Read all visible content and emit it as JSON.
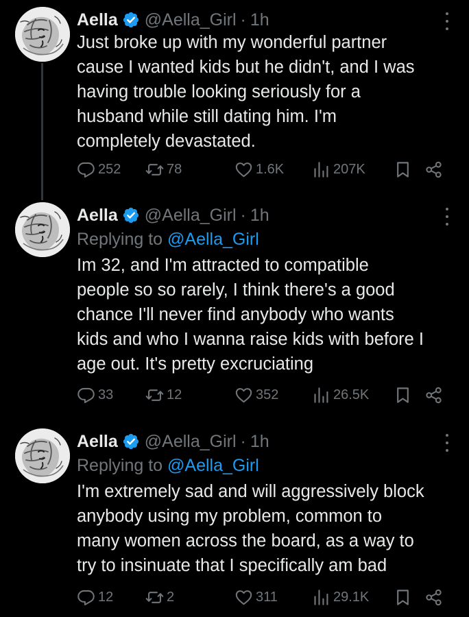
{
  "tweets": [
    {
      "name": "Aella",
      "handle": "@Aella_Girl",
      "dot": "·",
      "time": "1h",
      "reply_prefix": "",
      "reply_mention": "",
      "lines": [
        "Just broke up with my wonderful partner",
        "cause I wanted kids but he didn't, and I was",
        "having trouble looking seriously for a",
        "husband while still dating him. I'm",
        "completely devastated."
      ],
      "replies": "252",
      "reposts": "78",
      "likes": "1.6K",
      "views": "207K"
    },
    {
      "name": "Aella",
      "handle": "@Aella_Girl",
      "dot": "·",
      "time": "1h",
      "reply_prefix": "Replying to ",
      "reply_mention": "@Aella_Girl",
      "lines": [
        "Im 32, and I'm attracted to compatible",
        "people so so rarely, I think there's a good",
        "chance I'll never find anybody who wants",
        "kids and who I wanna raise kids with before I",
        "age out. It's pretty excruciating"
      ],
      "replies": "33",
      "reposts": "12",
      "likes": "352",
      "views": "26.5K"
    },
    {
      "name": "Aella",
      "handle": "@Aella_Girl",
      "dot": "·",
      "time": "1h",
      "reply_prefix": "Replying to ",
      "reply_mention": "@Aella_Girl",
      "lines": [
        "I'm extremely sad and will aggressively block",
        "anybody using my problem, common to",
        "many women across the board, as a way to",
        "try to insinuate that I specifically am bad"
      ],
      "replies": "12",
      "reposts": "2",
      "likes": "311",
      "views": "29.1K"
    }
  ],
  "colors": {
    "background": "#000000",
    "text": "#e7e9ea",
    "muted": "#71767b",
    "accent": "#1d9bf0"
  },
  "icons": [
    "more-icon",
    "verified-badge-icon",
    "reply-icon",
    "repost-icon",
    "like-icon",
    "views-icon",
    "bookmark-icon",
    "share-icon"
  ]
}
